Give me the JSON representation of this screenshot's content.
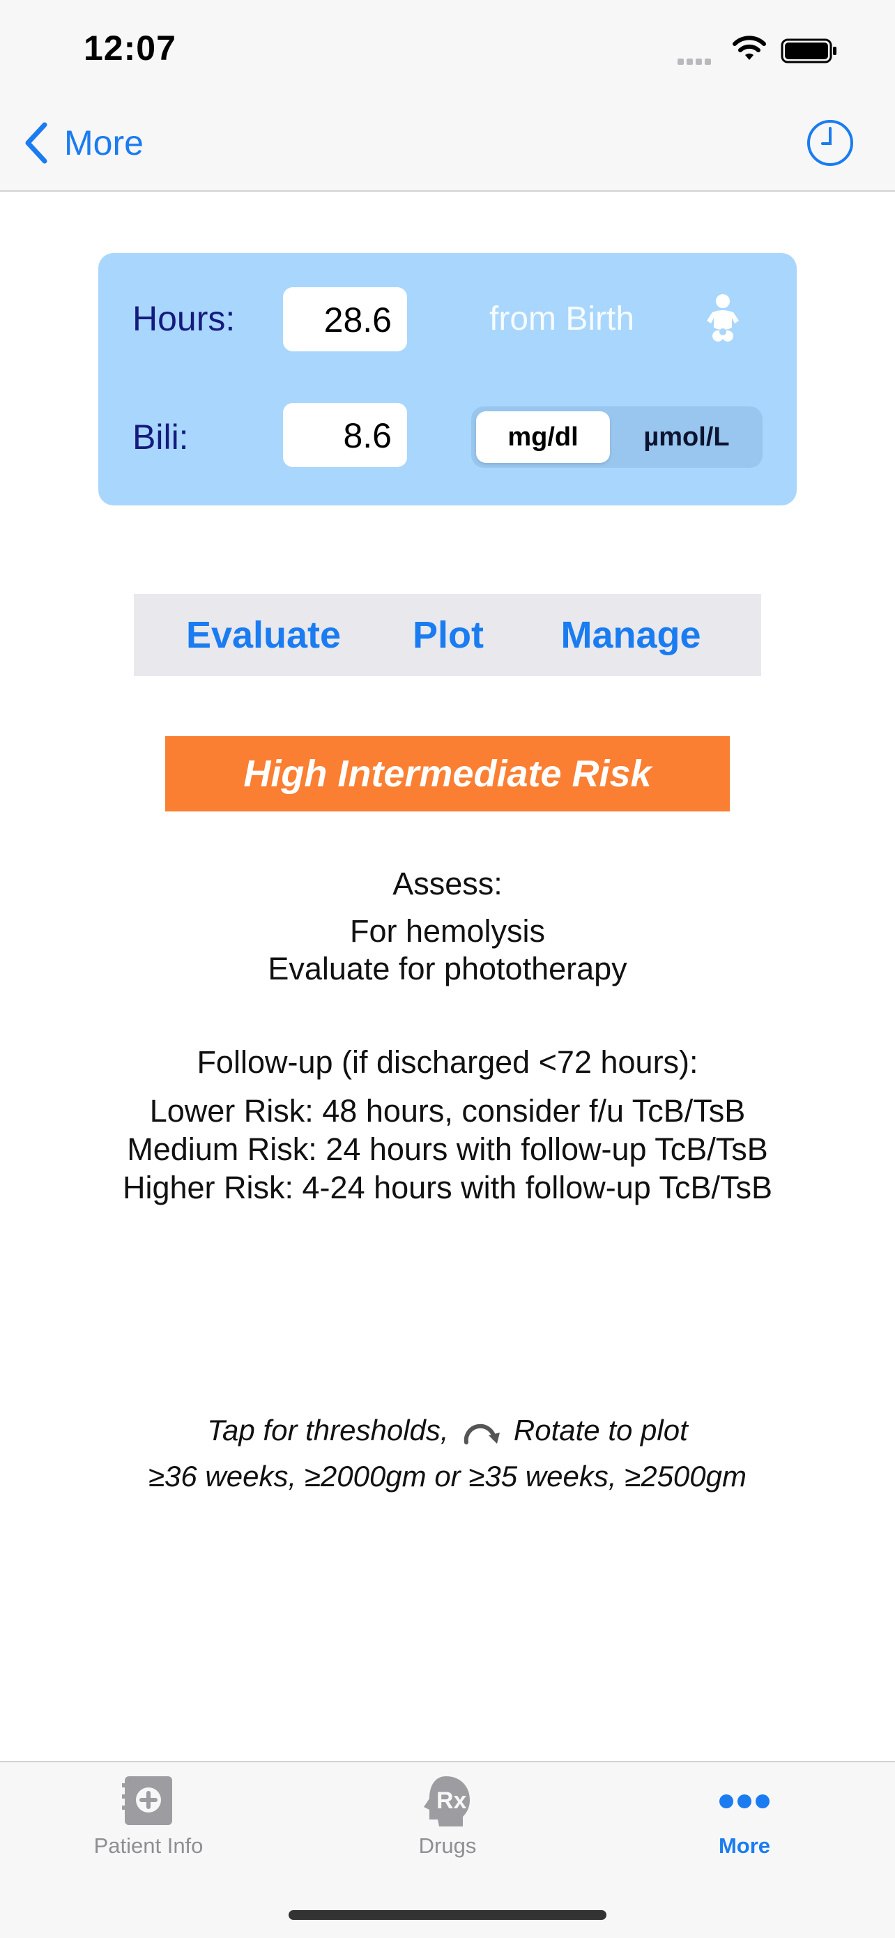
{
  "status_bar": {
    "time": "12:07"
  },
  "nav": {
    "back_label": "More"
  },
  "inputs": {
    "hours_label": "Hours:",
    "hours_value": "28.6",
    "from_birth": "from Birth",
    "bili_label": "Bili:",
    "bili_value": "8.6",
    "unit_options": [
      "mg/dl",
      "µmol/L"
    ],
    "unit_selected": "mg/dl"
  },
  "tabs": [
    {
      "label": "Evaluate"
    },
    {
      "label": "Plot"
    },
    {
      "label": "Manage"
    }
  ],
  "result": {
    "risk": "High Intermediate Risk"
  },
  "assess": {
    "heading": "Assess:",
    "items": [
      "For hemolysis",
      "Evaluate for phototherapy"
    ]
  },
  "followup": {
    "heading": "Follow-up (if discharged <72 hours):",
    "items": [
      "Lower Risk: 48 hours, consider f/u TcB/TsB",
      "Medium Risk: 24 hours with follow-up TcB/TsB",
      "Higher Risk: 4-24 hours with follow-up TcB/TsB"
    ]
  },
  "hint": {
    "tap": "Tap for thresholds,",
    "rotate": "Rotate to plot",
    "criteria": "≥36 weeks, ≥2000gm or ≥35 weeks, ≥2500gm"
  },
  "tab_bar": {
    "items": [
      {
        "label": "Patient Info",
        "icon": "patient-info-icon"
      },
      {
        "label": "Drugs",
        "icon": "drugs-rx-icon"
      },
      {
        "label": "More",
        "icon": "more-dots-icon"
      }
    ],
    "active": "More"
  },
  "colors": {
    "accent": "#1a7cf0",
    "panel": "#a9d6fd",
    "label_navy": "#151b7e",
    "risk_orange": "#fb7f32",
    "tab_inactive": "#8e8e93"
  }
}
